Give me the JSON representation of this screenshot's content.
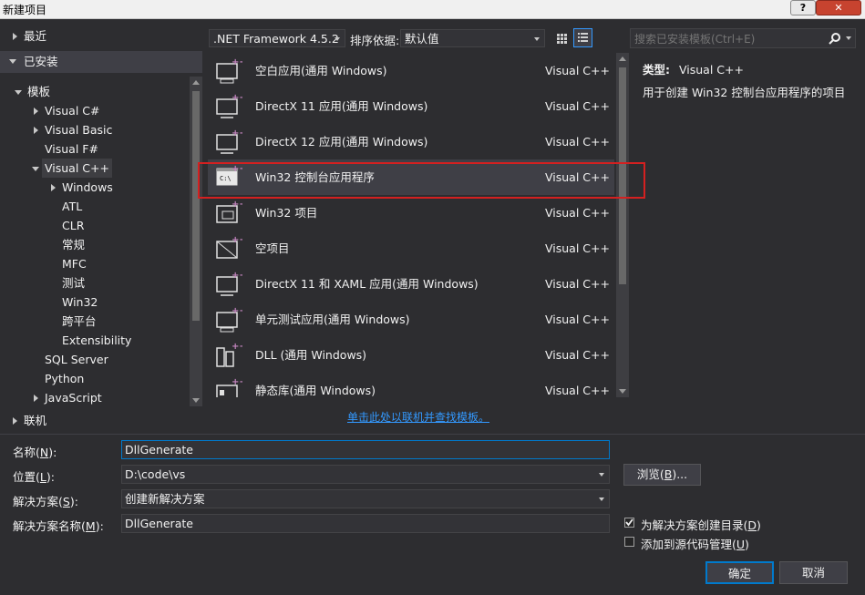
{
  "window": {
    "title": "新建项目",
    "help": "?",
    "close": "✕"
  },
  "left_tree": {
    "recent": "最近",
    "installed": "已安装",
    "templates": "模板",
    "items": [
      "Visual C#",
      "Visual Basic",
      "Visual F#",
      "Visual C++",
      "Windows",
      "ATL",
      "CLR",
      "常规",
      "MFC",
      "测试",
      "Win32",
      "跨平台",
      "Extensibility",
      "SQL Server",
      "Python",
      "JavaScript"
    ],
    "online": "联机"
  },
  "toolbar": {
    "framework": ".NET Framework 4.5.2",
    "sort_label": "排序依据:",
    "sort_value": "默认值",
    "search_placeholder": "搜索已安装模板(Ctrl+E)"
  },
  "templates": [
    {
      "name": "空白应用(通用 Windows)",
      "lang": "Visual C++",
      "icon": "blank-app-icon"
    },
    {
      "name": "DirectX 11 应用(通用 Windows)",
      "lang": "Visual C++",
      "icon": "directx-app-icon"
    },
    {
      "name": "DirectX 12 应用(通用 Windows)",
      "lang": "Visual C++",
      "icon": "directx-app-icon"
    },
    {
      "name": "Win32 控制台应用程序",
      "lang": "Visual C++",
      "icon": "console-app-icon",
      "selected": true
    },
    {
      "name": "Win32 项目",
      "lang": "Visual C++",
      "icon": "win32-project-icon"
    },
    {
      "name": "空项目",
      "lang": "Visual C++",
      "icon": "empty-project-icon"
    },
    {
      "name": "DirectX 11 和 XAML 应用(通用 Windows)",
      "lang": "Visual C++",
      "icon": "directx-xaml-icon"
    },
    {
      "name": "单元测试应用(通用 Windows)",
      "lang": "Visual C++",
      "icon": "unit-test-icon"
    },
    {
      "name": "DLL (通用 Windows)",
      "lang": "Visual C++",
      "icon": "dll-icon"
    },
    {
      "name": "静态库(通用 Windows)",
      "lang": "Visual C++",
      "icon": "static-lib-icon"
    }
  ],
  "online_link": "单击此处以联机并查找模板。",
  "description": {
    "type_label": "类型:",
    "type_value": "Visual C++",
    "text": "用于创建 Win32 控制台应用程序的项目"
  },
  "form": {
    "name_label": "名称(N):",
    "name_value": "DllGenerate",
    "location_label": "位置(L):",
    "location_value": "D:\\code\\vs",
    "solution_label": "解决方案(S):",
    "solution_value": "创建新解决方案",
    "solution_name_label": "解决方案名称(M):",
    "solution_name_value": "DllGenerate",
    "browse": "浏览(B)...",
    "create_dir": "为解决方案创建目录(D)",
    "create_dir_checked": true,
    "add_source_control": "添加到源代码管理(U)",
    "add_source_control_checked": false,
    "ok": "确定",
    "cancel": "取消"
  },
  "colors": {
    "background": "#2d2d30",
    "accent": "#007acc",
    "highlight": "#d42020",
    "link": "#3399ff"
  }
}
